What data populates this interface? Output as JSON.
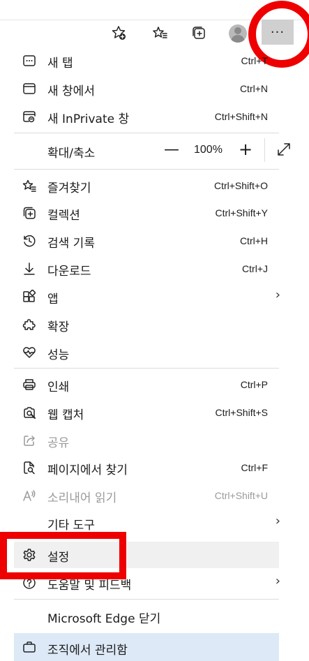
{
  "toolbar": {
    "more_label": "···"
  },
  "menu": {
    "new_tab": {
      "label": "새 탭",
      "shortcut": "Ctrl+T"
    },
    "new_window": {
      "label": "새 창에서",
      "shortcut": "Ctrl+N"
    },
    "new_inprivate": {
      "label": "새 InPrivate 창",
      "shortcut": "Ctrl+Shift+N"
    },
    "zoom": {
      "label": "확대/축소",
      "minus": "—",
      "value": "100%",
      "plus": "+"
    },
    "favorites": {
      "label": "즐겨찾기",
      "shortcut": "Ctrl+Shift+O"
    },
    "collections": {
      "label": "컬렉션",
      "shortcut": "Ctrl+Shift+Y"
    },
    "history": {
      "label": "검색 기록",
      "shortcut": "Ctrl+H"
    },
    "downloads": {
      "label": "다운로드",
      "shortcut": "Ctrl+J"
    },
    "apps": {
      "label": "앱",
      "arrow": "›"
    },
    "extensions": {
      "label": "확장"
    },
    "performance": {
      "label": "성능"
    },
    "print": {
      "label": "인쇄",
      "shortcut": "Ctrl+P"
    },
    "web_capture": {
      "label": "웹 캡처",
      "shortcut": "Ctrl+Shift+S"
    },
    "share": {
      "label": "공유"
    },
    "find": {
      "label": "페이지에서 찾기",
      "shortcut": "Ctrl+F"
    },
    "read_aloud": {
      "label": "소리내어 읽기",
      "shortcut": "Ctrl+Shift+U"
    },
    "more_tools": {
      "label": "기타 도구",
      "arrow": "›"
    },
    "settings": {
      "label": "설정"
    },
    "help": {
      "label": "도움말 및 피드백",
      "arrow": "›"
    },
    "close": {
      "label": "Microsoft Edge 닫기"
    },
    "managed": {
      "label": "조직에서 관리함"
    }
  },
  "colors": {
    "annotation_red": "#ee0000",
    "hover_gray": "#f0f0f0",
    "managed_blue": "#dde9f7"
  }
}
